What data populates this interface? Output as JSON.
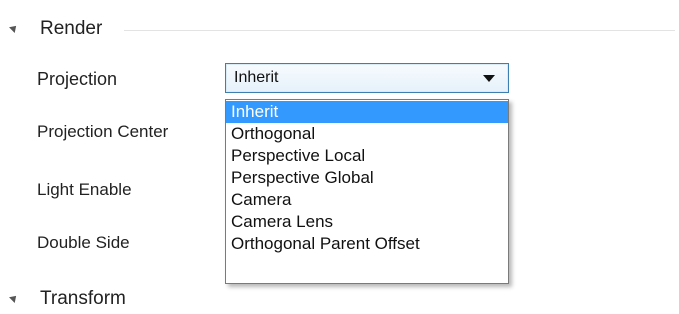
{
  "render_section": {
    "title": "Render",
    "properties": [
      {
        "label": "Projection"
      },
      {
        "label": "Projection Center"
      },
      {
        "label": "Light Enable"
      },
      {
        "label": "Double Side"
      }
    ]
  },
  "projection_dropdown": {
    "selected_value": "Inherit",
    "options": [
      "Inherit",
      "Orthogonal",
      "Perspective Local",
      "Perspective Global",
      "Camera",
      "Camera Lens",
      "Orthogonal Parent Offset"
    ],
    "highlight_color": "#3399ff"
  },
  "transform_section": {
    "title": "Transform"
  }
}
